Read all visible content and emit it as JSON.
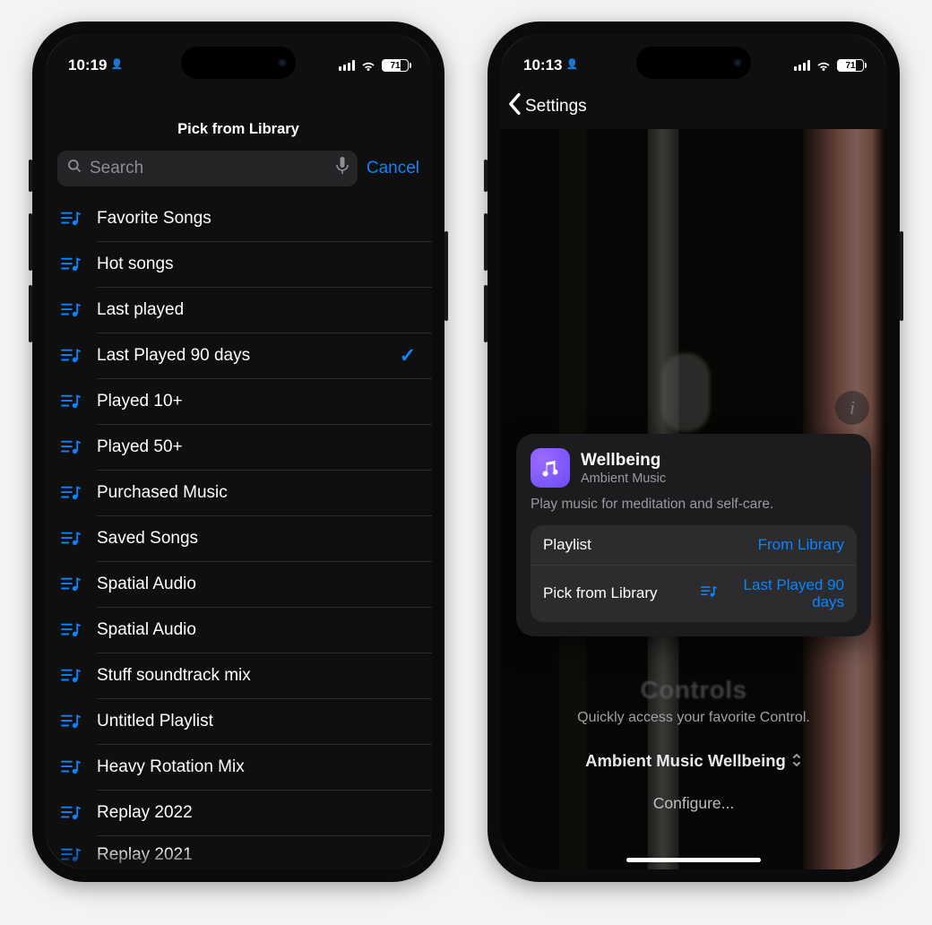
{
  "left": {
    "status": {
      "time": "10:19",
      "battery": "71"
    },
    "sheet_title": "Pick from Library",
    "search": {
      "placeholder": "Search"
    },
    "cancel": "Cancel",
    "selected_index": 3,
    "playlists": [
      "Favorite Songs",
      "Hot songs",
      "Last played",
      "Last Played 90 days",
      "Played 10+",
      "Played 50+",
      "Purchased Music",
      "Saved Songs",
      "Spatial Audio",
      "Spatial Audio",
      "Stuff soundtrack mix",
      "Untitled Playlist",
      "Heavy Rotation Mix",
      "Replay 2022",
      "Replay 2021"
    ]
  },
  "right": {
    "status": {
      "time": "10:13",
      "battery": "71"
    },
    "back_label": "Settings",
    "card": {
      "title": "Wellbeing",
      "subtitle": "Ambient Music",
      "description": "Play music for meditation and self-care.",
      "rows": {
        "playlist": {
          "label": "Playlist",
          "value": "From Library"
        },
        "pick": {
          "label": "Pick from Library",
          "value": "Last Played 90 days"
        }
      }
    },
    "background": {
      "controls_title": "Controls",
      "subtitle": "Quickly access your favorite Control.",
      "picker_value": "Ambient Music Wellbeing",
      "configure": "Configure..."
    }
  }
}
